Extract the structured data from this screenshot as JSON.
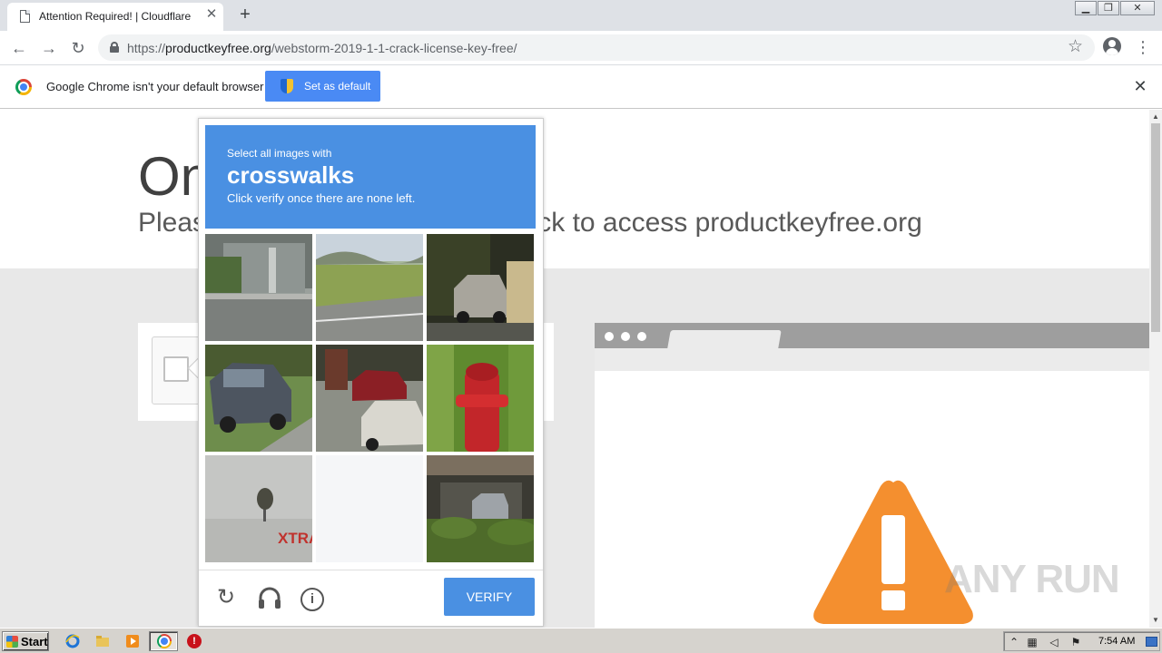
{
  "browser": {
    "tab_title": "Attention Required! | Cloudflare",
    "url_scheme": "https://",
    "url_host": "productkeyfree.org",
    "url_path": "/webstorm-2019-1-1-crack-license-key-free/"
  },
  "infobar": {
    "message": "Google Chrome isn't your default browser",
    "set_default_label": "Set as default"
  },
  "page": {
    "headline": "One more step",
    "subline": "Please complete the security check to access productkeyfree.org"
  },
  "challenge": {
    "prefix": "Select all images with",
    "target": "crosswalks",
    "instruction": "Click verify once there are none left.",
    "verify_label": "VERIFY",
    "tiles": [
      {
        "description": "building-sidewalk"
      },
      {
        "description": "field-road"
      },
      {
        "description": "car-in-dark"
      },
      {
        "description": "parked-car"
      },
      {
        "description": "cars-street"
      },
      {
        "description": "fire-hydrant"
      },
      {
        "description": "palm-sign",
        "text": "XTRA"
      },
      {
        "description": "blank-fading"
      },
      {
        "description": "car-bushes"
      }
    ]
  },
  "watermark": "ANY RUN",
  "taskbar": {
    "start_label": "Start",
    "clock": "7:54 AM"
  },
  "colors": {
    "accent_blue": "#4a90e2",
    "infobar_button": "#4a8af4",
    "warning_orange": "#f48f2f"
  }
}
